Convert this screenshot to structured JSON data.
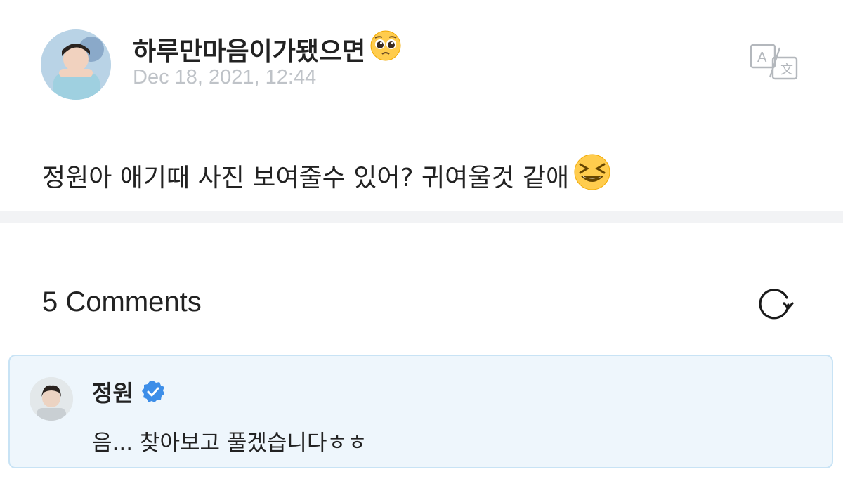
{
  "post": {
    "author": "하루만마음이가됐으면",
    "author_emoji": "pleading-face",
    "date": "Dec 18, 2021, 12:44",
    "body": "정원아 애기때 사진 보여줄수 있어? 귀여울것 같애",
    "body_emoji": "grinning-squinting-face"
  },
  "comments": {
    "count_label": "5 Comments",
    "items": [
      {
        "author": "정원",
        "verified": true,
        "text": "음... 찾아보고 풀겠습니다ㅎㅎ"
      }
    ]
  },
  "colors": {
    "comment_bg": "#eef6fc",
    "comment_border": "#c8e3f5",
    "verified_blue": "#3d8ee8",
    "date_gray": "#bfc3c8"
  }
}
